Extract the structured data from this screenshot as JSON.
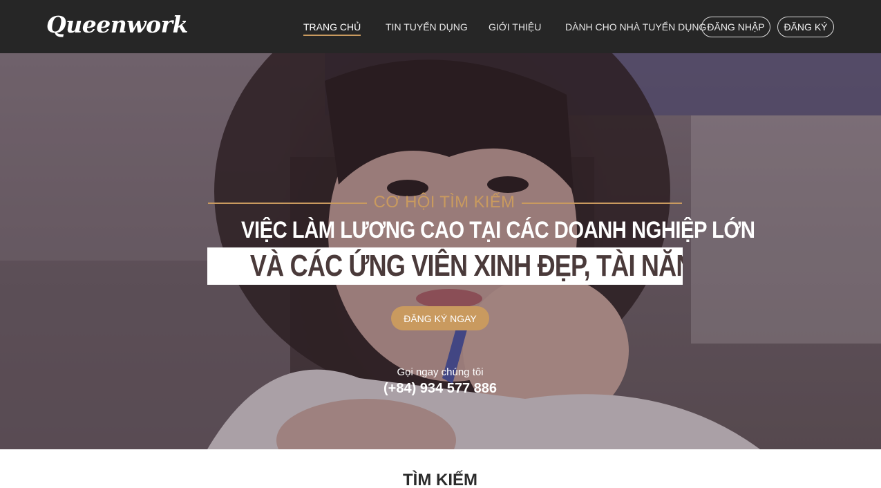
{
  "header": {
    "logo": "Queenwork",
    "nav": [
      {
        "label": "TRANG CHỦ",
        "active": true
      },
      {
        "label": "TIN TUYỂN DỤNG",
        "active": false
      },
      {
        "label": "GIỚI THIỆU",
        "active": false
      },
      {
        "label": "DÀNH CHO NHÀ TUYỂN DỤNG",
        "active": false
      }
    ],
    "login_label": "ĐĂNG NHẬP",
    "register_label": "ĐĂNG KÝ"
  },
  "hero": {
    "eyebrow": "CƠ HỘI TÌM KIẾM",
    "headline_1": "VIỆC LÀM LƯƠNG CAO TẠI CÁC DOANH NGHIỆP LỚN",
    "headline_2": "VÀ CÁC ỨNG VIÊN XINH ĐẸP, TÀI NĂNG",
    "cta_label": "ĐĂNG KÝ NGAY",
    "call_label": "Gọi ngay chúng tôi",
    "phone": "(+84) 934 577 886"
  },
  "search_section": {
    "title": "TÌM KIẾM"
  },
  "colors": {
    "header_bg": "#262626",
    "accent": "#c99a5f",
    "hero_tint": "#4a3a3a"
  }
}
